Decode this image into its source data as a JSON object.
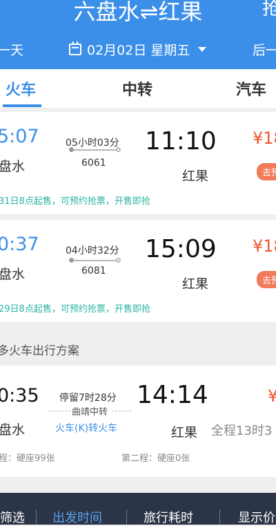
{
  "header": {
    "title": "六盘水⇌红果",
    "title_right": "抢",
    "prev_day": "一天",
    "date": "02月02日 星期五",
    "next_day": "后一"
  },
  "tabs": [
    "火车",
    "中转",
    "汽车"
  ],
  "trains": [
    {
      "dep_time": "5:07",
      "dep_station": "盘水",
      "duration": "05小时03分",
      "train_no": "6061",
      "arr_time": "11:10",
      "arr_station": "红果",
      "price": "¥18",
      "badge": "去预",
      "notice": "31日8点起售，可预约抢票，开售即抢"
    },
    {
      "dep_time": "0:37",
      "dep_station": "盘水",
      "duration": "04小时32分",
      "train_no": "6081",
      "arr_time": "15:09",
      "arr_station": "红果",
      "price": "¥18",
      "badge": "去预",
      "notice": "29日8点起售，可预约抢票，开售即抢"
    }
  ],
  "section_title": "多火车出行方案",
  "transfer": {
    "dep_time": "0:35",
    "dep_station": "盘水",
    "stay": "停留7时28分",
    "via": "曲靖中转",
    "type": "火车(K)转火车",
    "arr_time": "14:14",
    "arr_station": "红果",
    "price": "¥",
    "total": "全程13时3",
    "leg1": "程：硬座99张",
    "leg2": "第二程：硬座0张"
  },
  "bottom_bar": [
    "筛选",
    "出发时间",
    "旅行耗时",
    "显示价"
  ],
  "colors": {
    "primary": "#3b8fe8",
    "price": "#f0532f",
    "notice": "#2ab3a0",
    "bottom_bar": "#2c3447"
  }
}
